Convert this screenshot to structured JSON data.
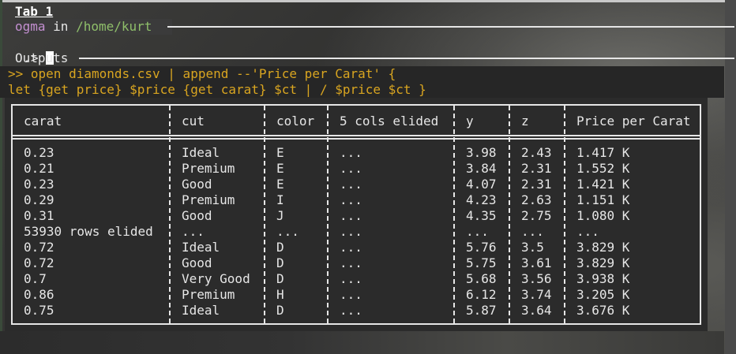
{
  "tab": {
    "title": "Tab 1"
  },
  "header": {
    "user": "ogma",
    "in_word": "in",
    "path": "/home/kurt"
  },
  "prompt": {
    "symbol": ".>"
  },
  "outputs": {
    "label": "Outputs"
  },
  "command": {
    "line1": ">> open diamonds.csv | append --'Price per Carat' {",
    "line2": "let {get price} $price {get carat} $ct | / $price $ct }"
  },
  "table": {
    "columns": [
      "carat",
      "cut",
      "color",
      "5 cols elided",
      "y",
      "z",
      "Price per Carat"
    ],
    "rows": [
      [
        "0.23",
        "Ideal",
        "E",
        "...",
        "3.98",
        "2.43",
        "1.417 K"
      ],
      [
        "0.21",
        "Premium",
        "E",
        "...",
        "3.84",
        "2.31",
        "1.552 K"
      ],
      [
        "0.23",
        "Good",
        "E",
        "...",
        "4.07",
        "2.31",
        "1.421 K"
      ],
      [
        "0.29",
        "Premium",
        "I",
        "...",
        "4.23",
        "2.63",
        "1.151 K"
      ],
      [
        "0.31",
        "Good",
        "J",
        "...",
        "4.35",
        "2.75",
        "1.080 K"
      ],
      [
        "53930 rows elided",
        "...",
        "...",
        "...",
        "...",
        "...",
        "..."
      ],
      [
        "0.72",
        "Ideal",
        "D",
        "...",
        "5.76",
        "3.5",
        "3.829 K"
      ],
      [
        "0.72",
        "Good",
        "D",
        "...",
        "5.75",
        "3.61",
        "3.829 K"
      ],
      [
        "0.7",
        "Very Good",
        "D",
        "...",
        "5.68",
        "3.56",
        "3.938 K"
      ],
      [
        "0.86",
        "Premium",
        "H",
        "...",
        "6.12",
        "3.74",
        "3.205 K"
      ],
      [
        "0.75",
        "Ideal",
        "D",
        "...",
        "5.87",
        "3.64",
        "3.676 K"
      ]
    ]
  }
}
